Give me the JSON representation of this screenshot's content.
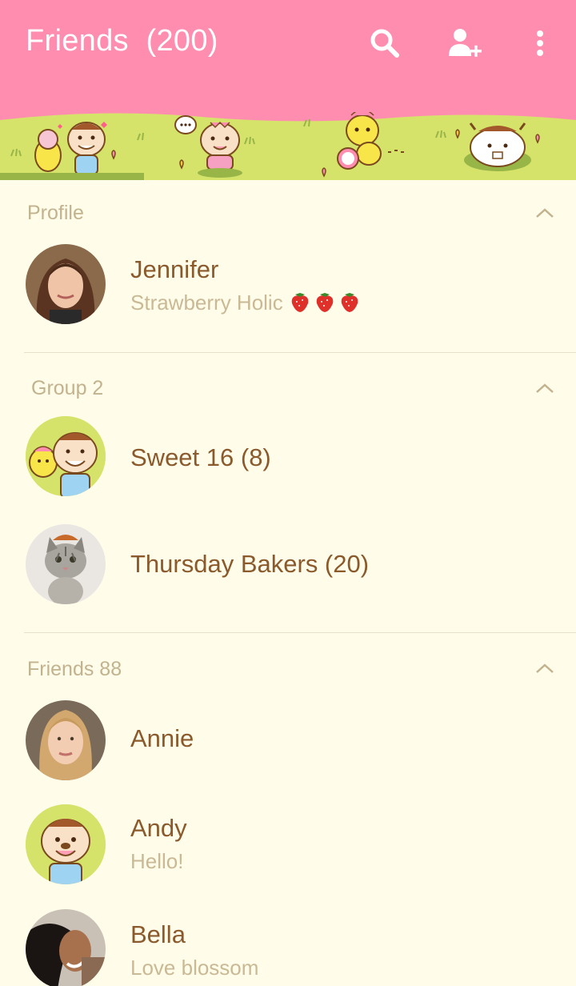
{
  "header": {
    "title": "Friends",
    "count": "(200)",
    "icons": [
      "search-icon",
      "add-friend-icon",
      "more-vertical-icon"
    ]
  },
  "colors": {
    "header_bg": "#ff8db0",
    "banner_bg": "#d6e36b",
    "tab_active": "#98b548",
    "page_bg": "#fffcea",
    "name_text": "#8a5a2c",
    "status_text": "#c9b994"
  },
  "banner": {
    "tabs": [
      "friends-tab",
      "chats-tab",
      "timeline-tab",
      "more-tab"
    ],
    "active_tab": 0
  },
  "sections": [
    {
      "label": "Profile",
      "items": [
        {
          "name": "Jennifer",
          "status": "Strawberry Holic"
        }
      ]
    },
    {
      "label": "Group 2",
      "items": [
        {
          "name": "Sweet 16 (8)"
        },
        {
          "name": "Thursday Bakers (20)"
        }
      ]
    },
    {
      "label": "Friends 88",
      "items": [
        {
          "name": "Annie"
        },
        {
          "name": "Andy",
          "status": "Hello!"
        },
        {
          "name": "Bella",
          "status": "Love blossom"
        }
      ]
    }
  ]
}
